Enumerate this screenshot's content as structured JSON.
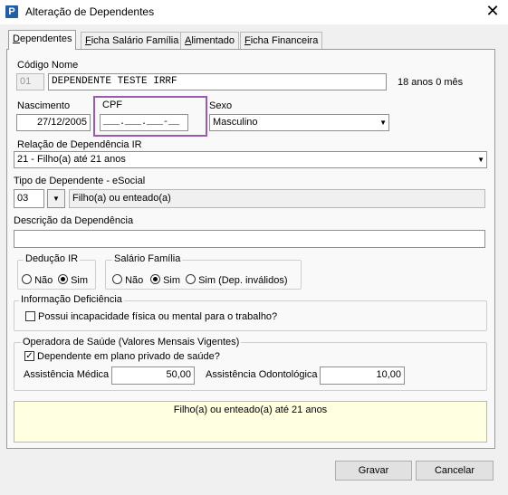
{
  "window": {
    "title": "Alteração de Dependentes",
    "icon_glyph": "P",
    "close_glyph": "✕"
  },
  "tabs": [
    {
      "label_u": "D",
      "label_rest": "ependentes"
    },
    {
      "label_u": "F",
      "label_rest": "icha Salário Família"
    },
    {
      "label_u": "A",
      "label_rest": "limentado"
    },
    {
      "label_u": "F",
      "label_rest": "icha Financeira"
    }
  ],
  "form": {
    "codigo_nome_label": "Código Nome",
    "codigo_value": "01",
    "nome_value": "DEPENDENTE TESTE IRRF",
    "age_text": "18 anos 0 mês",
    "nascimento_label": "Nascimento",
    "nascimento_value": "27/12/2005",
    "cpf_label": "CPF",
    "cpf_value": "___.___.___-__",
    "sexo_label": "Sexo",
    "sexo_value": "Masculino",
    "relacao_label": "Relação de Dependência IR",
    "relacao_value": "21 - Filho(a) até 21 anos",
    "tipo_label": "Tipo de Dependente - eSocial",
    "tipo_code": "03",
    "tipo_desc": "Filho(a) ou enteado(a)",
    "descricao_label": "Descrição da Dependência",
    "descricao_value": ""
  },
  "deducao_ir": {
    "title": "Dedução IR",
    "options": [
      "Não",
      "Sim"
    ],
    "selected": "Sim"
  },
  "salario_familia": {
    "title": "Salário Família",
    "options": [
      "Não",
      "Sim",
      "Sim (Dep. inválidos)"
    ],
    "selected": "Sim"
  },
  "deficiencia": {
    "title": "Informação Deficiência",
    "checkbox_label": "Possui incapacidade física ou mental para o trabalho?",
    "checked": false
  },
  "saude": {
    "title": "Operadora de Saúde (Valores Mensais Vigentes)",
    "checkbox_label": "Dependente em plano privado de saúde?",
    "checked": true,
    "check_glyph": "✓",
    "medica_label": "Assistência Médica",
    "medica_value": "50,00",
    "odonto_label": "Assistência Odontológica",
    "odonto_value": "10,00"
  },
  "info_note": "Filho(a) ou enteado(a) até 21 anos",
  "buttons": {
    "gravar": "Gravar",
    "cancelar": "Cancelar"
  },
  "colors": {
    "highlight": "#9b59b6",
    "note_bg": "#ffffe1"
  }
}
